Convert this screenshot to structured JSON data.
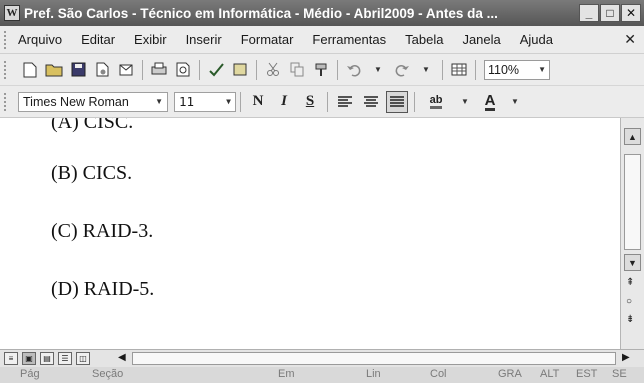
{
  "window": {
    "title": "Pref. São Carlos - Técnico em Informática - Médio - Abril2009 - Antes da ...",
    "app_icon": "W",
    "minimize_label": "_",
    "restore_label": "□",
    "close_label": "✕"
  },
  "menu": {
    "items": [
      "Arquivo",
      "Editar",
      "Exibir",
      "Inserir",
      "Formatar",
      "Ferramentas",
      "Tabela",
      "Janela",
      "Ajuda"
    ],
    "close_label": "✕"
  },
  "toolbar": {
    "zoom": "110%",
    "icons": [
      "new-doc-icon",
      "open-icon",
      "save-icon",
      "permission-icon",
      "print-icon",
      "print-preview-icon",
      "spelling-icon",
      "research-icon",
      "cut-icon",
      "copy-icon",
      "format-painter-icon",
      "undo-icon",
      "redo-icon",
      "table-icon"
    ]
  },
  "format": {
    "font": "Times New Roman",
    "size": "11",
    "bold": "N",
    "italic": "I",
    "underline": "S",
    "highlight_label": "ab",
    "font_color_label": "A"
  },
  "document": {
    "options": [
      "(A) CISC.",
      "(B) CICS.",
      "(C) RAID-3.",
      "(D) RAID-5."
    ]
  },
  "status": {
    "page": "Pág",
    "section": "Seção",
    "at": "Em",
    "line": "Lin",
    "col": "Col",
    "rec": "GRA",
    "track": "ALT",
    "ext": "EST",
    "ovr": "SE"
  },
  "colors": {
    "titlebar": "#6a6a6a",
    "chrome": "#ececec",
    "document_bg": "#ffffff"
  }
}
